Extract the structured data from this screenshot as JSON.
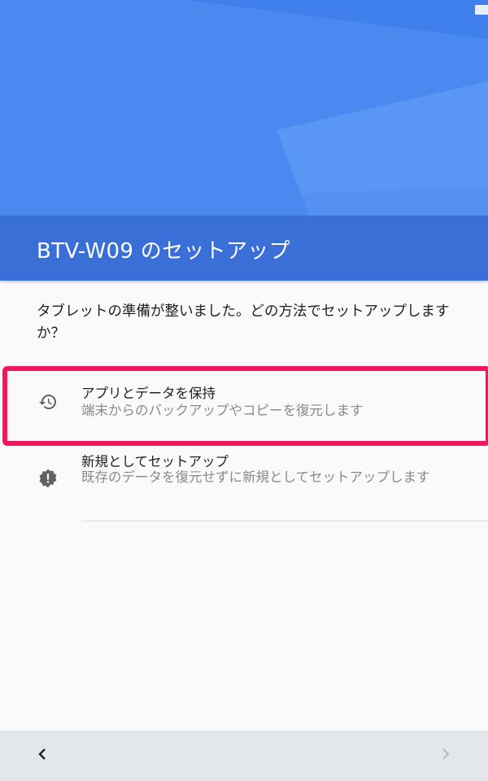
{
  "status_bar": {
    "icons": [
      "wifi-icon",
      "battery-icon"
    ]
  },
  "header": {
    "title": "BTV-W09 のセットアップ",
    "colors": {
      "hero": "#4a8af0",
      "band": "#3a6fd8"
    }
  },
  "main": {
    "question": "タブレットの準備が整いました。どの方法でセットアップしますか？",
    "options": [
      {
        "icon": "history-icon",
        "title": "アプリとデータを保持",
        "description": "端末からのバックアップやコピーを復元します",
        "highlighted": true
      },
      {
        "icon": "alert-badge-icon",
        "title": "新規としてセットアップ",
        "description": "既存のデータを復元せずに新規としてセットアップします",
        "highlighted": false
      }
    ],
    "highlight_color": "#f0185a"
  },
  "nav": {
    "back_icon": "chevron-left-icon",
    "next_icon": "chevron-right-icon"
  }
}
